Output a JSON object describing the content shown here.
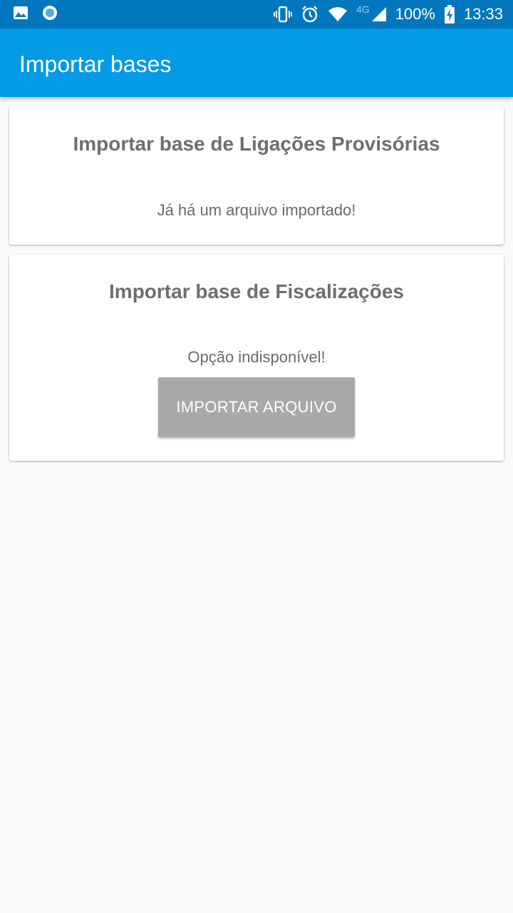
{
  "status_bar": {
    "network_type": "4G",
    "battery": "100%",
    "time": "13:33",
    "icons": [
      "image-icon",
      "circle-notification-icon",
      "vibrate-icon",
      "alarm-icon",
      "wifi-icon",
      "cell-signal-icon",
      "battery-charging-icon"
    ]
  },
  "app_bar": {
    "title": "Importar bases",
    "color": "#039be5"
  },
  "cards": [
    {
      "title": "Importar base de Ligações Provisórias",
      "message": "Já há um arquivo importado!"
    },
    {
      "title": "Importar base de Fiscalizações",
      "message": "Opção indisponível!",
      "button_label": "IMPORTAR ARQUIVO",
      "button_color": "#a9a9a9"
    }
  ]
}
